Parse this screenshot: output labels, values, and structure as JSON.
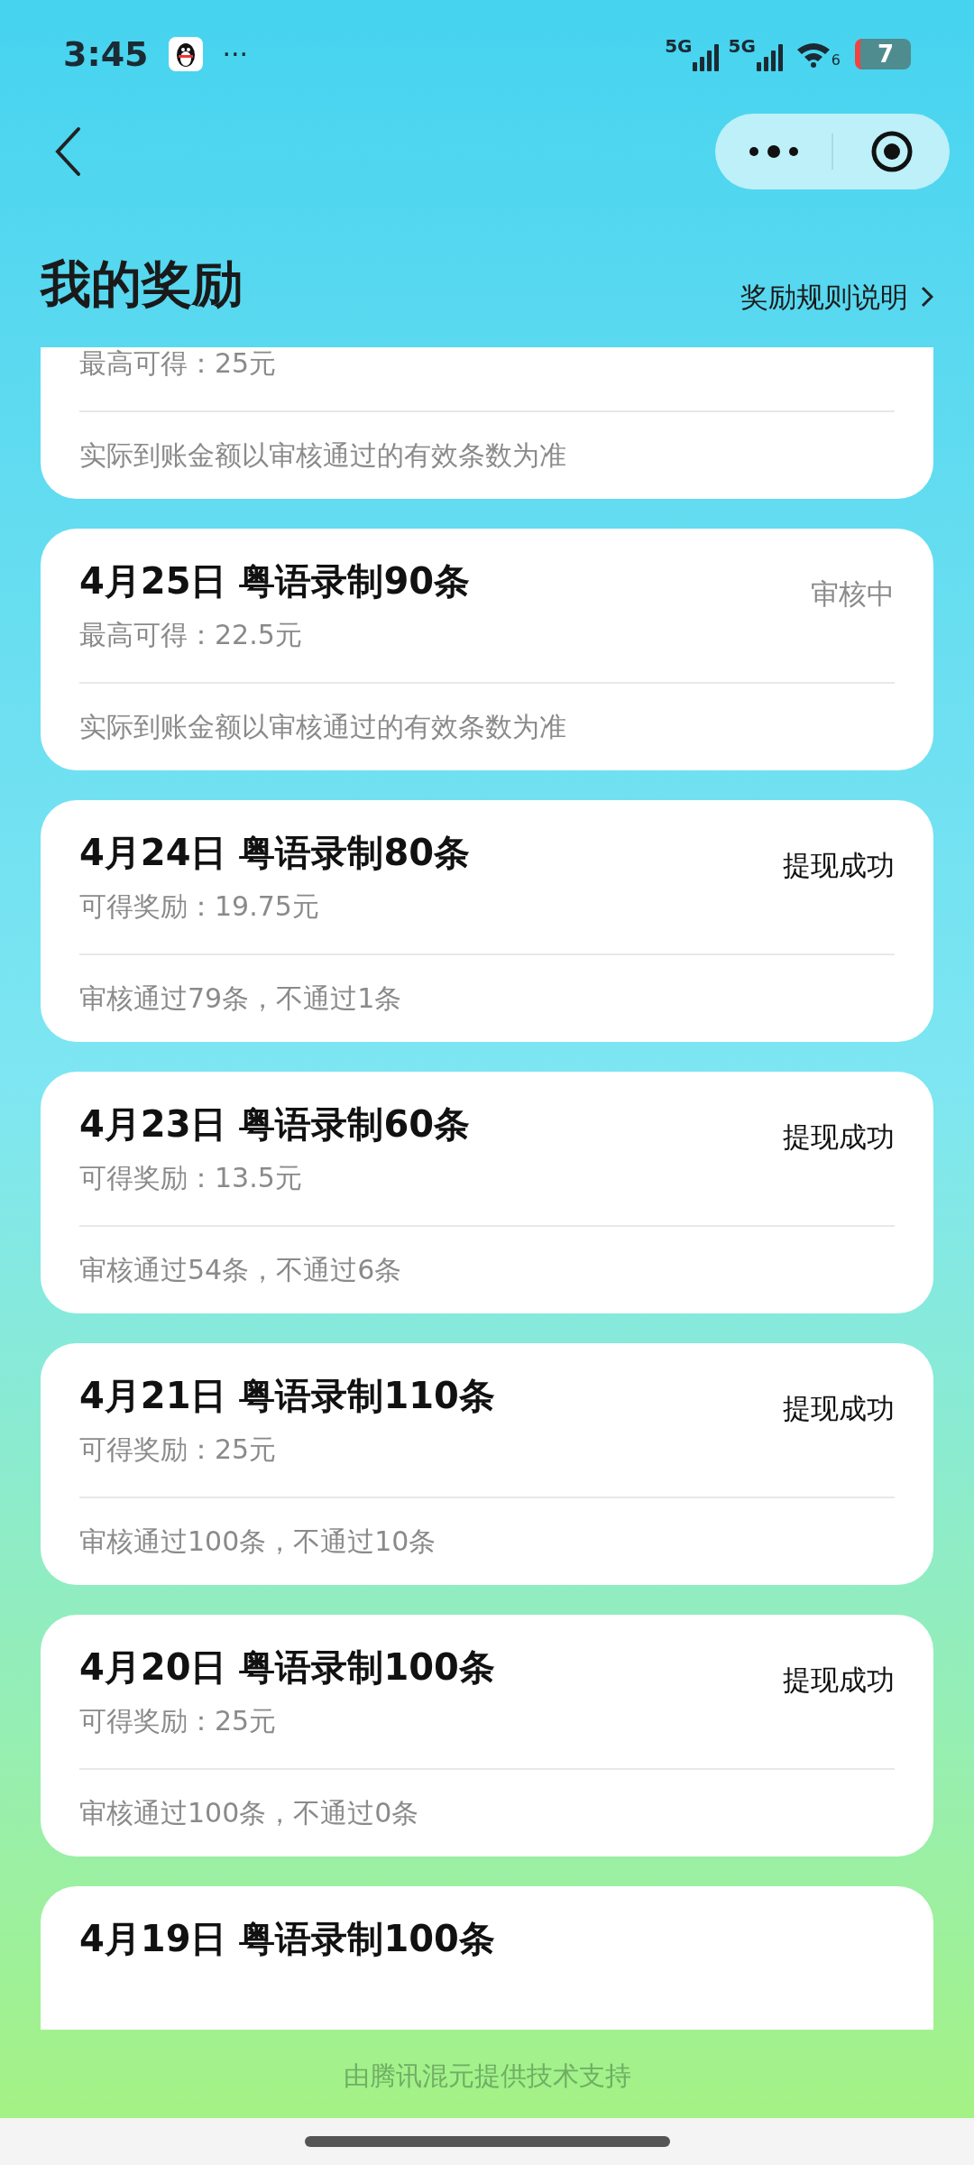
{
  "status_bar": {
    "time": "3:45",
    "more": "···",
    "networks": [
      "5G",
      "5G"
    ],
    "wifi_badge": "6",
    "battery": "7"
  },
  "header": {
    "title": "我的奖励",
    "rules_link": "奖励规则说明"
  },
  "records": [
    {
      "reward": "最高可得：25元",
      "note": "实际到账金额以审核通过的有效条数为准"
    },
    {
      "title": "4月25日 粤语录制90条",
      "status": "审核中",
      "completed": false,
      "reward": "最高可得：22.5元",
      "note": "实际到账金额以审核通过的有效条数为准"
    },
    {
      "title": "4月24日 粤语录制80条",
      "status": "提现成功",
      "completed": true,
      "reward": "可得奖励：19.75元",
      "note": "审核通过79条，不通过1条"
    },
    {
      "title": "4月23日 粤语录制60条",
      "status": "提现成功",
      "completed": true,
      "reward": "可得奖励：13.5元",
      "note": "审核通过54条，不通过6条"
    },
    {
      "title": "4月21日 粤语录制110条",
      "status": "提现成功",
      "completed": true,
      "reward": "可得奖励：25元",
      "note": "审核通过100条，不通过10条"
    },
    {
      "title": "4月20日 粤语录制100条",
      "status": "提现成功",
      "completed": true,
      "reward": "可得奖励：25元",
      "note": "审核通过100条，不通过0条"
    },
    {
      "title": "4月19日 粤语录制100条"
    }
  ],
  "footer": "由腾讯混元提供技术支持"
}
